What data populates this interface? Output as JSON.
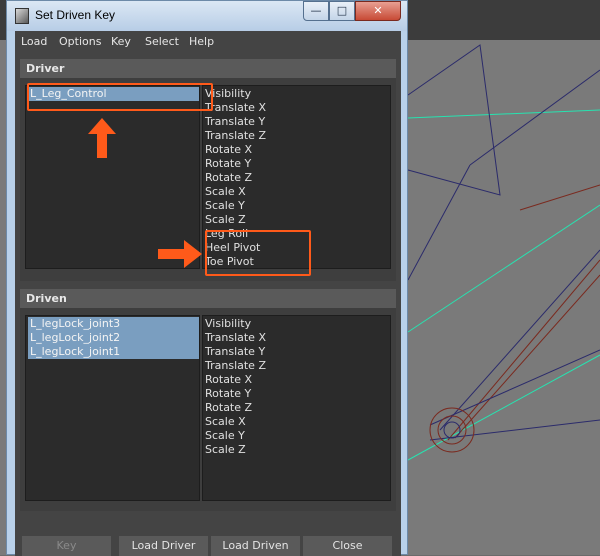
{
  "window": {
    "title": "Set Driven Key",
    "controls": {
      "minimize": "—",
      "maximize": "□",
      "close": "✕"
    },
    "app_icon": "maya-icon"
  },
  "menu": [
    "Load",
    "Options",
    "Key",
    "Select",
    "Help"
  ],
  "driver": {
    "header": "Driver",
    "objects": [
      {
        "label": "L_Leg_Control",
        "selected": true
      }
    ],
    "attributes": [
      "Visibility",
      "Translate X",
      "Translate Y",
      "Translate Z",
      "Rotate X",
      "Rotate Y",
      "Rotate Z",
      "Scale X",
      "Scale Y",
      "Scale Z",
      "Leg Roll",
      "Heel Pivot",
      "Toe Pivot"
    ]
  },
  "driven": {
    "header": "Driven",
    "objects": [
      {
        "label": "L_legLock_joint3",
        "selected": true
      },
      {
        "label": "L_legLock_joint2",
        "selected": true
      },
      {
        "label": "L_legLock_joint1",
        "selected": true
      }
    ],
    "attributes": [
      "Visibility",
      "Translate X",
      "Translate Y",
      "Translate Z",
      "Rotate X",
      "Rotate Y",
      "Rotate Z",
      "Scale X",
      "Scale Y",
      "Scale Z"
    ]
  },
  "buttons": {
    "key": "Key",
    "load_driver": "Load Driver",
    "load_driven": "Load Driven",
    "close": "Close"
  },
  "annotations": {
    "highlight_color": "#ff5a1a",
    "arrow_icons": [
      "up-arrow-icon",
      "right-arrow-icon"
    ]
  },
  "colors": {
    "selection": "#7a9ec0",
    "panel": "#444444",
    "list_bg": "#2b2b2b"
  }
}
